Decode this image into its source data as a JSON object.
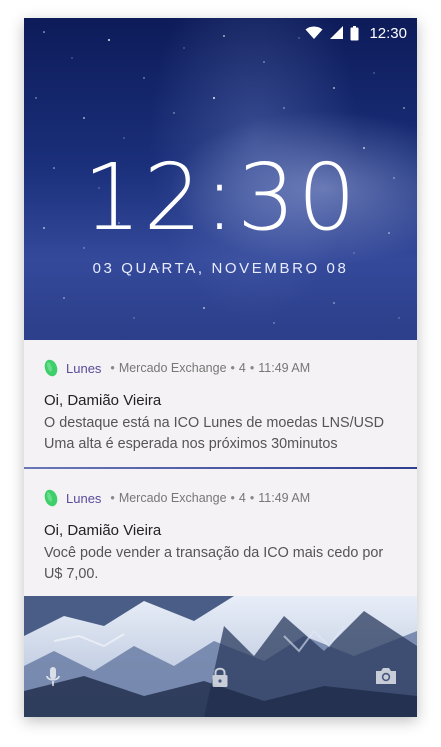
{
  "status_bar": {
    "time": "12:30",
    "icons": [
      "wifi-icon",
      "signal-icon",
      "battery-icon"
    ]
  },
  "lockscreen": {
    "clock": "12:30",
    "date": "03 QUARTA, NOVEMBRO 08"
  },
  "notifications": [
    {
      "app_name": "Lunes",
      "meta_source": "Mercado Exchange",
      "meta_count": "4",
      "meta_time": "11:49 AM",
      "title": "Oi, Damião Vieira",
      "body": "O destaque está na ICO Lunes de moedas LNS/USD Uma alta é esperada nos próximos 30minutos"
    },
    {
      "app_name": "Lunes",
      "meta_source": "Mercado Exchange",
      "meta_count": "4",
      "meta_time": "11:49 AM",
      "title": "Oi, Damião Vieira",
      "body": "Você pode vender a transação da ICO mais cedo por U$ 7,00."
    }
  ],
  "bottom_bar": {
    "icons": [
      "microphone-icon",
      "lock-icon",
      "camera-icon"
    ]
  },
  "colors": {
    "app_name": "#5b4a9a",
    "app_icon": "#3ecf6a",
    "notification_bg": "#f4f2f4",
    "divider": "#2f3f8f"
  }
}
